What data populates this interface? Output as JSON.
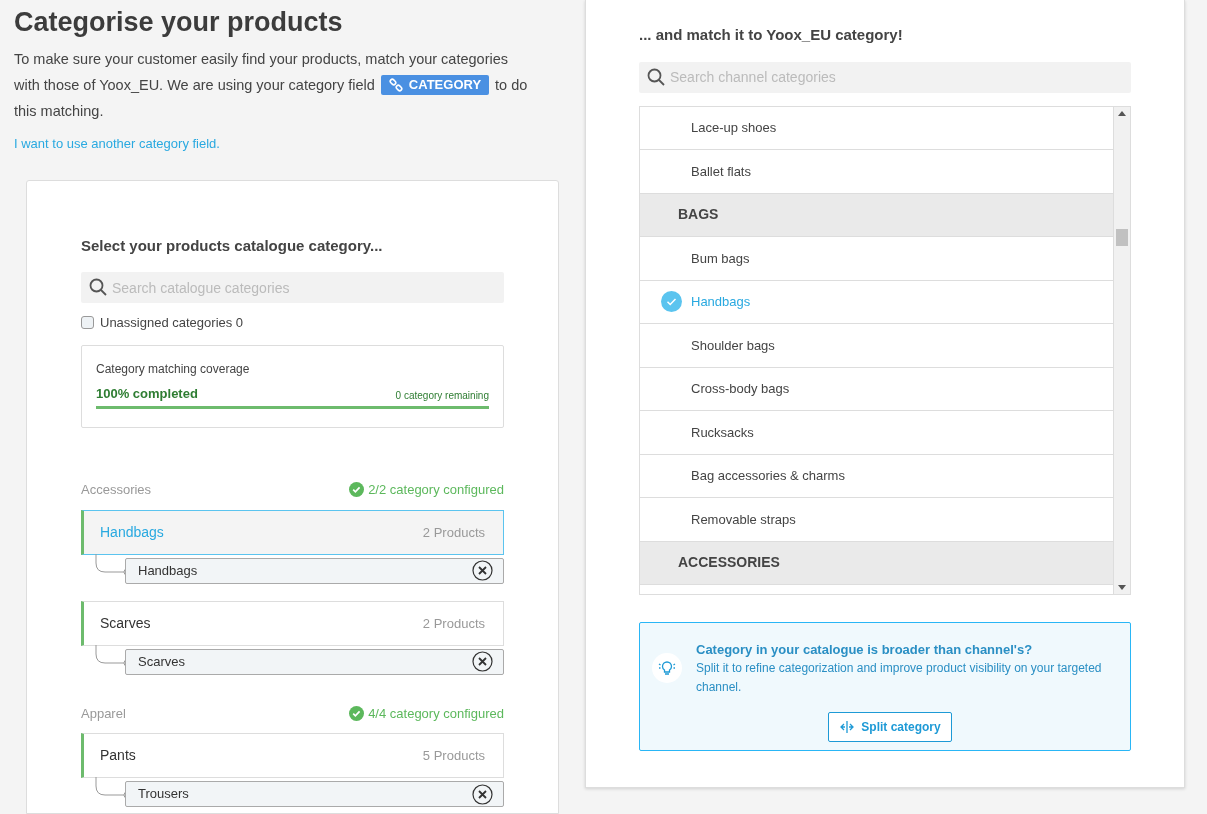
{
  "header": {
    "title": "Categorise your products",
    "intro_line1": "To make sure your customer easily find your products, match your categories",
    "intro_line2": "with those of Yoox_EU. We are using your category field",
    "field_badge": "CATEGORY",
    "intro_line2_end": "to do",
    "intro_line3": "this matching.",
    "link": "I want to use another category field."
  },
  "catalogue": {
    "heading": "Select your products catalogue category...",
    "search": {
      "placeholder": "Search catalogue categories"
    },
    "unassigned": {
      "label": "Unassigned categories 0",
      "checked": false
    },
    "coverage": {
      "title": "Category matching coverage",
      "completed": "100% completed",
      "remaining": "0 category remaining",
      "level": 1
    },
    "groups": [
      {
        "name": "Accessories",
        "status": "2/2 category configured",
        "categories": [
          {
            "name": "Handbags",
            "count": "2 Products",
            "selected": true,
            "mapped": "Handbags"
          },
          {
            "name": "Scarves",
            "count": "2 Products",
            "selected": false,
            "mapped": "Scarves"
          }
        ]
      },
      {
        "name": "Apparel",
        "status": "4/4 category configured",
        "categories": [
          {
            "name": "Pants",
            "count": "5 Products",
            "selected": false,
            "mapped": "Trousers"
          }
        ]
      }
    ]
  },
  "channel": {
    "heading": "... and match it to Yoox_EU category!",
    "search": {
      "placeholder": "Search channel categories"
    },
    "items": [
      {
        "kind": "item",
        "label": "Lace-up shoes",
        "selected": false
      },
      {
        "kind": "item",
        "label": "Ballet flats",
        "selected": false
      },
      {
        "kind": "header",
        "label": "BAGS"
      },
      {
        "kind": "item",
        "label": "Bum bags",
        "selected": false
      },
      {
        "kind": "item",
        "label": "Handbags",
        "selected": true
      },
      {
        "kind": "item",
        "label": "Shoulder bags",
        "selected": false
      },
      {
        "kind": "item",
        "label": "Cross-body bags",
        "selected": false
      },
      {
        "kind": "item",
        "label": "Rucksacks",
        "selected": false
      },
      {
        "kind": "item",
        "label": "Bag accessories & charms",
        "selected": false
      },
      {
        "kind": "item",
        "label": "Removable straps",
        "selected": false
      },
      {
        "kind": "header",
        "label": "ACCESSORIES"
      }
    ],
    "tip": {
      "title": "Category in your catalogue is broader than channel's?",
      "text": "Split it to refine categorization and improve product visibility on your targeted channel.",
      "button": "Split category"
    }
  }
}
